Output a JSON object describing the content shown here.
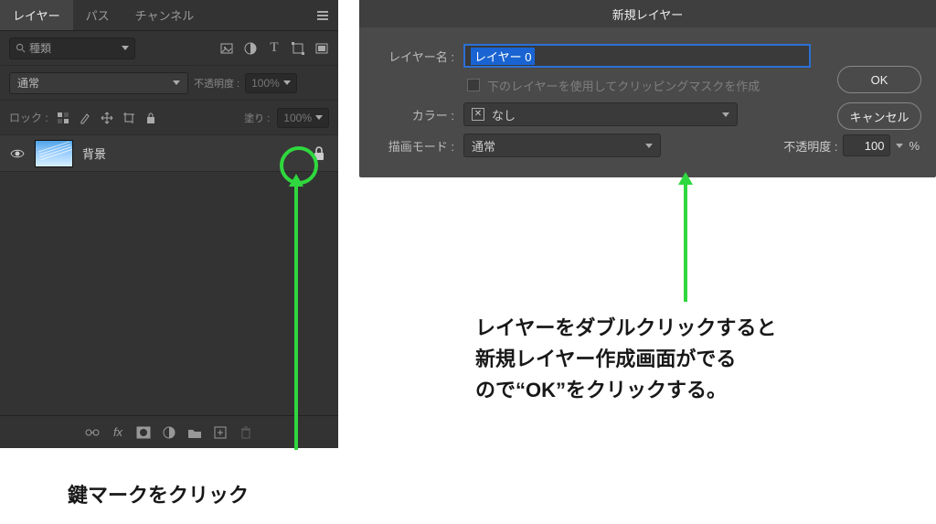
{
  "layers_panel": {
    "tabs": {
      "layers": "レイヤー",
      "paths": "パス",
      "channels": "チャンネル"
    },
    "search_placeholder": "種類",
    "blend_mode": "通常",
    "opacity_label": "不透明度 :",
    "opacity_value": "100%",
    "lock_label": "ロック :",
    "fill_label": "塗り :",
    "fill_value": "100%",
    "layer": {
      "name": "背景"
    }
  },
  "dialog": {
    "title": "新規レイヤー",
    "name_label": "レイヤー名 :",
    "name_value": "レイヤー 0",
    "clip_checkbox_label": "下のレイヤーを使用してクリッピングマスクを作成",
    "color_label": "カラー :",
    "color_value": "なし",
    "mode_label": "描画モード :",
    "mode_value": "通常",
    "opacity_label": "不透明度 :",
    "opacity_value": "100",
    "opacity_suffix": "%",
    "ok": "OK",
    "cancel": "キャンセル"
  },
  "annotations": {
    "left": "鍵マークをクリック",
    "right": "レイヤーをダブルクリックすると\n新規レイヤー作成画面がでる\nので“OK”をクリックする。"
  }
}
